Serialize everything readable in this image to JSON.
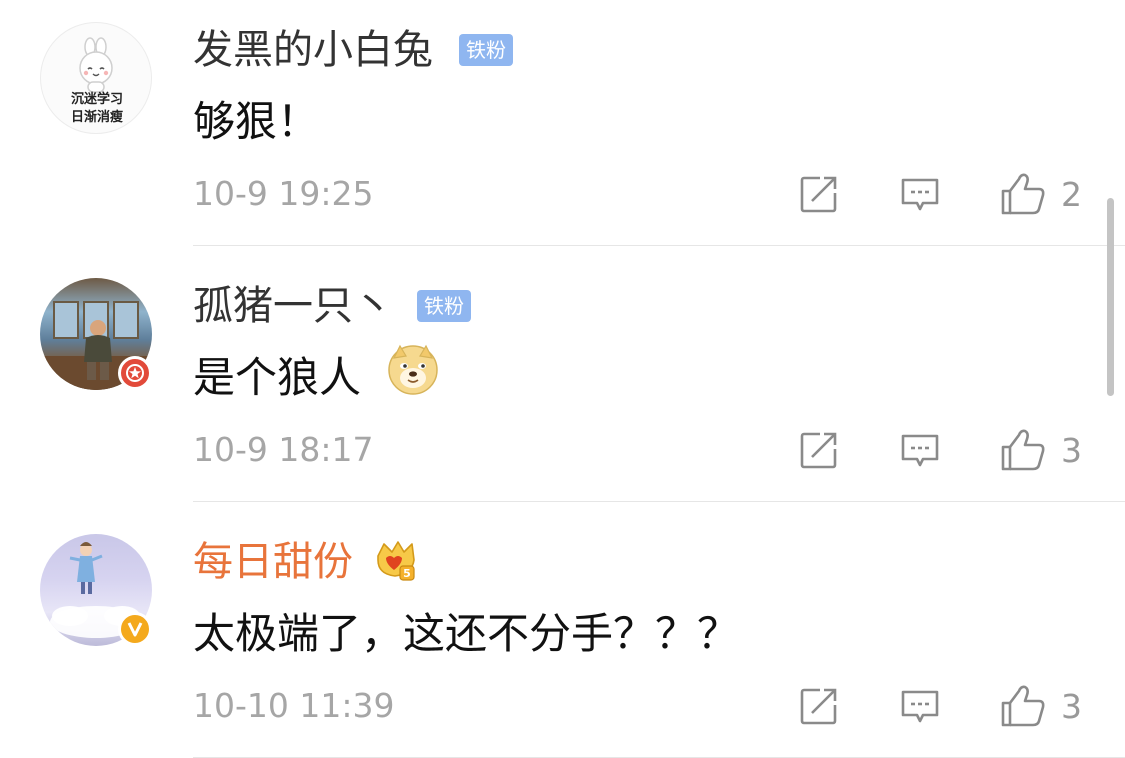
{
  "comments": [
    {
      "user": "发黑的小白兔",
      "fan_tag": "铁粉",
      "avatar_lines": [
        "沉迷学习",
        "日渐消瘦"
      ],
      "text": "够狠！",
      "time": "10-9 19:25",
      "likes": "2"
    },
    {
      "user": "孤猪一只丶",
      "fan_tag": "铁粉",
      "text": "是个狼人",
      "emoji": "doge-emoji",
      "time": "10-9 18:17",
      "likes": "3"
    },
    {
      "user": "每日甜份",
      "level_badge": "crown-icon",
      "text": "太极端了，这还不分手？？？",
      "time": "10-10 11:39",
      "likes": "3"
    }
  ],
  "colors": {
    "name": "#333333",
    "vip_name": "#e8743b",
    "fan_tag_bg": "#8fb6f0",
    "meta": "#a6a6a6",
    "verified_red": "#e24a3a",
    "verified_gold": "#f4a91d"
  }
}
